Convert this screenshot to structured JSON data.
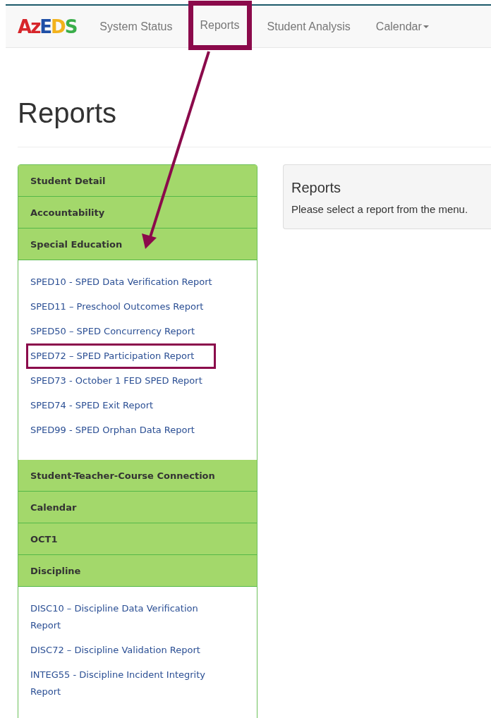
{
  "navbar": {
    "logo": "AzEDS",
    "items": [
      {
        "label": "System Status",
        "highlighted": false,
        "dropdown": false
      },
      {
        "label": "Reports",
        "highlighted": true,
        "dropdown": false
      },
      {
        "label": "Student Analysis",
        "highlighted": false,
        "dropdown": false
      },
      {
        "label": "Calendar",
        "highlighted": false,
        "dropdown": true
      }
    ]
  },
  "page_title": "Reports",
  "sidebar": {
    "sections": [
      {
        "title": "Student Detail"
      },
      {
        "title": "Accountability"
      },
      {
        "title": "Special Education",
        "links": [
          {
            "label": "SPED10 - SPED Data Verification Report",
            "highlighted": false
          },
          {
            "label": "SPED11 – Preschool Outcomes Report",
            "highlighted": false
          },
          {
            "label": "SPED50 – SPED Concurrency Report",
            "highlighted": false
          },
          {
            "label": "SPED72 – SPED Participation Report",
            "highlighted": true
          },
          {
            "label": "SPED73 - October 1 FED SPED Report",
            "highlighted": false
          },
          {
            "label": "SPED74 - SPED Exit Report",
            "highlighted": false
          },
          {
            "label": "SPED99 - SPED Orphan Data Report",
            "highlighted": false
          }
        ]
      },
      {
        "title": "Student-Teacher-Course Connection"
      },
      {
        "title": "Calendar"
      },
      {
        "title": "OCT1"
      },
      {
        "title": "Discipline",
        "links": [
          {
            "label": "DISC10 – Discipline Data Verification Report",
            "highlighted": false
          },
          {
            "label": "DISC72 – Discipline Validation Report",
            "highlighted": false
          },
          {
            "label": "INTEG55 - Discipline Incident Integrity Report",
            "highlighted": false
          }
        ]
      }
    ]
  },
  "panel": {
    "title": "Reports",
    "message": "Please select a report from the menu."
  }
}
